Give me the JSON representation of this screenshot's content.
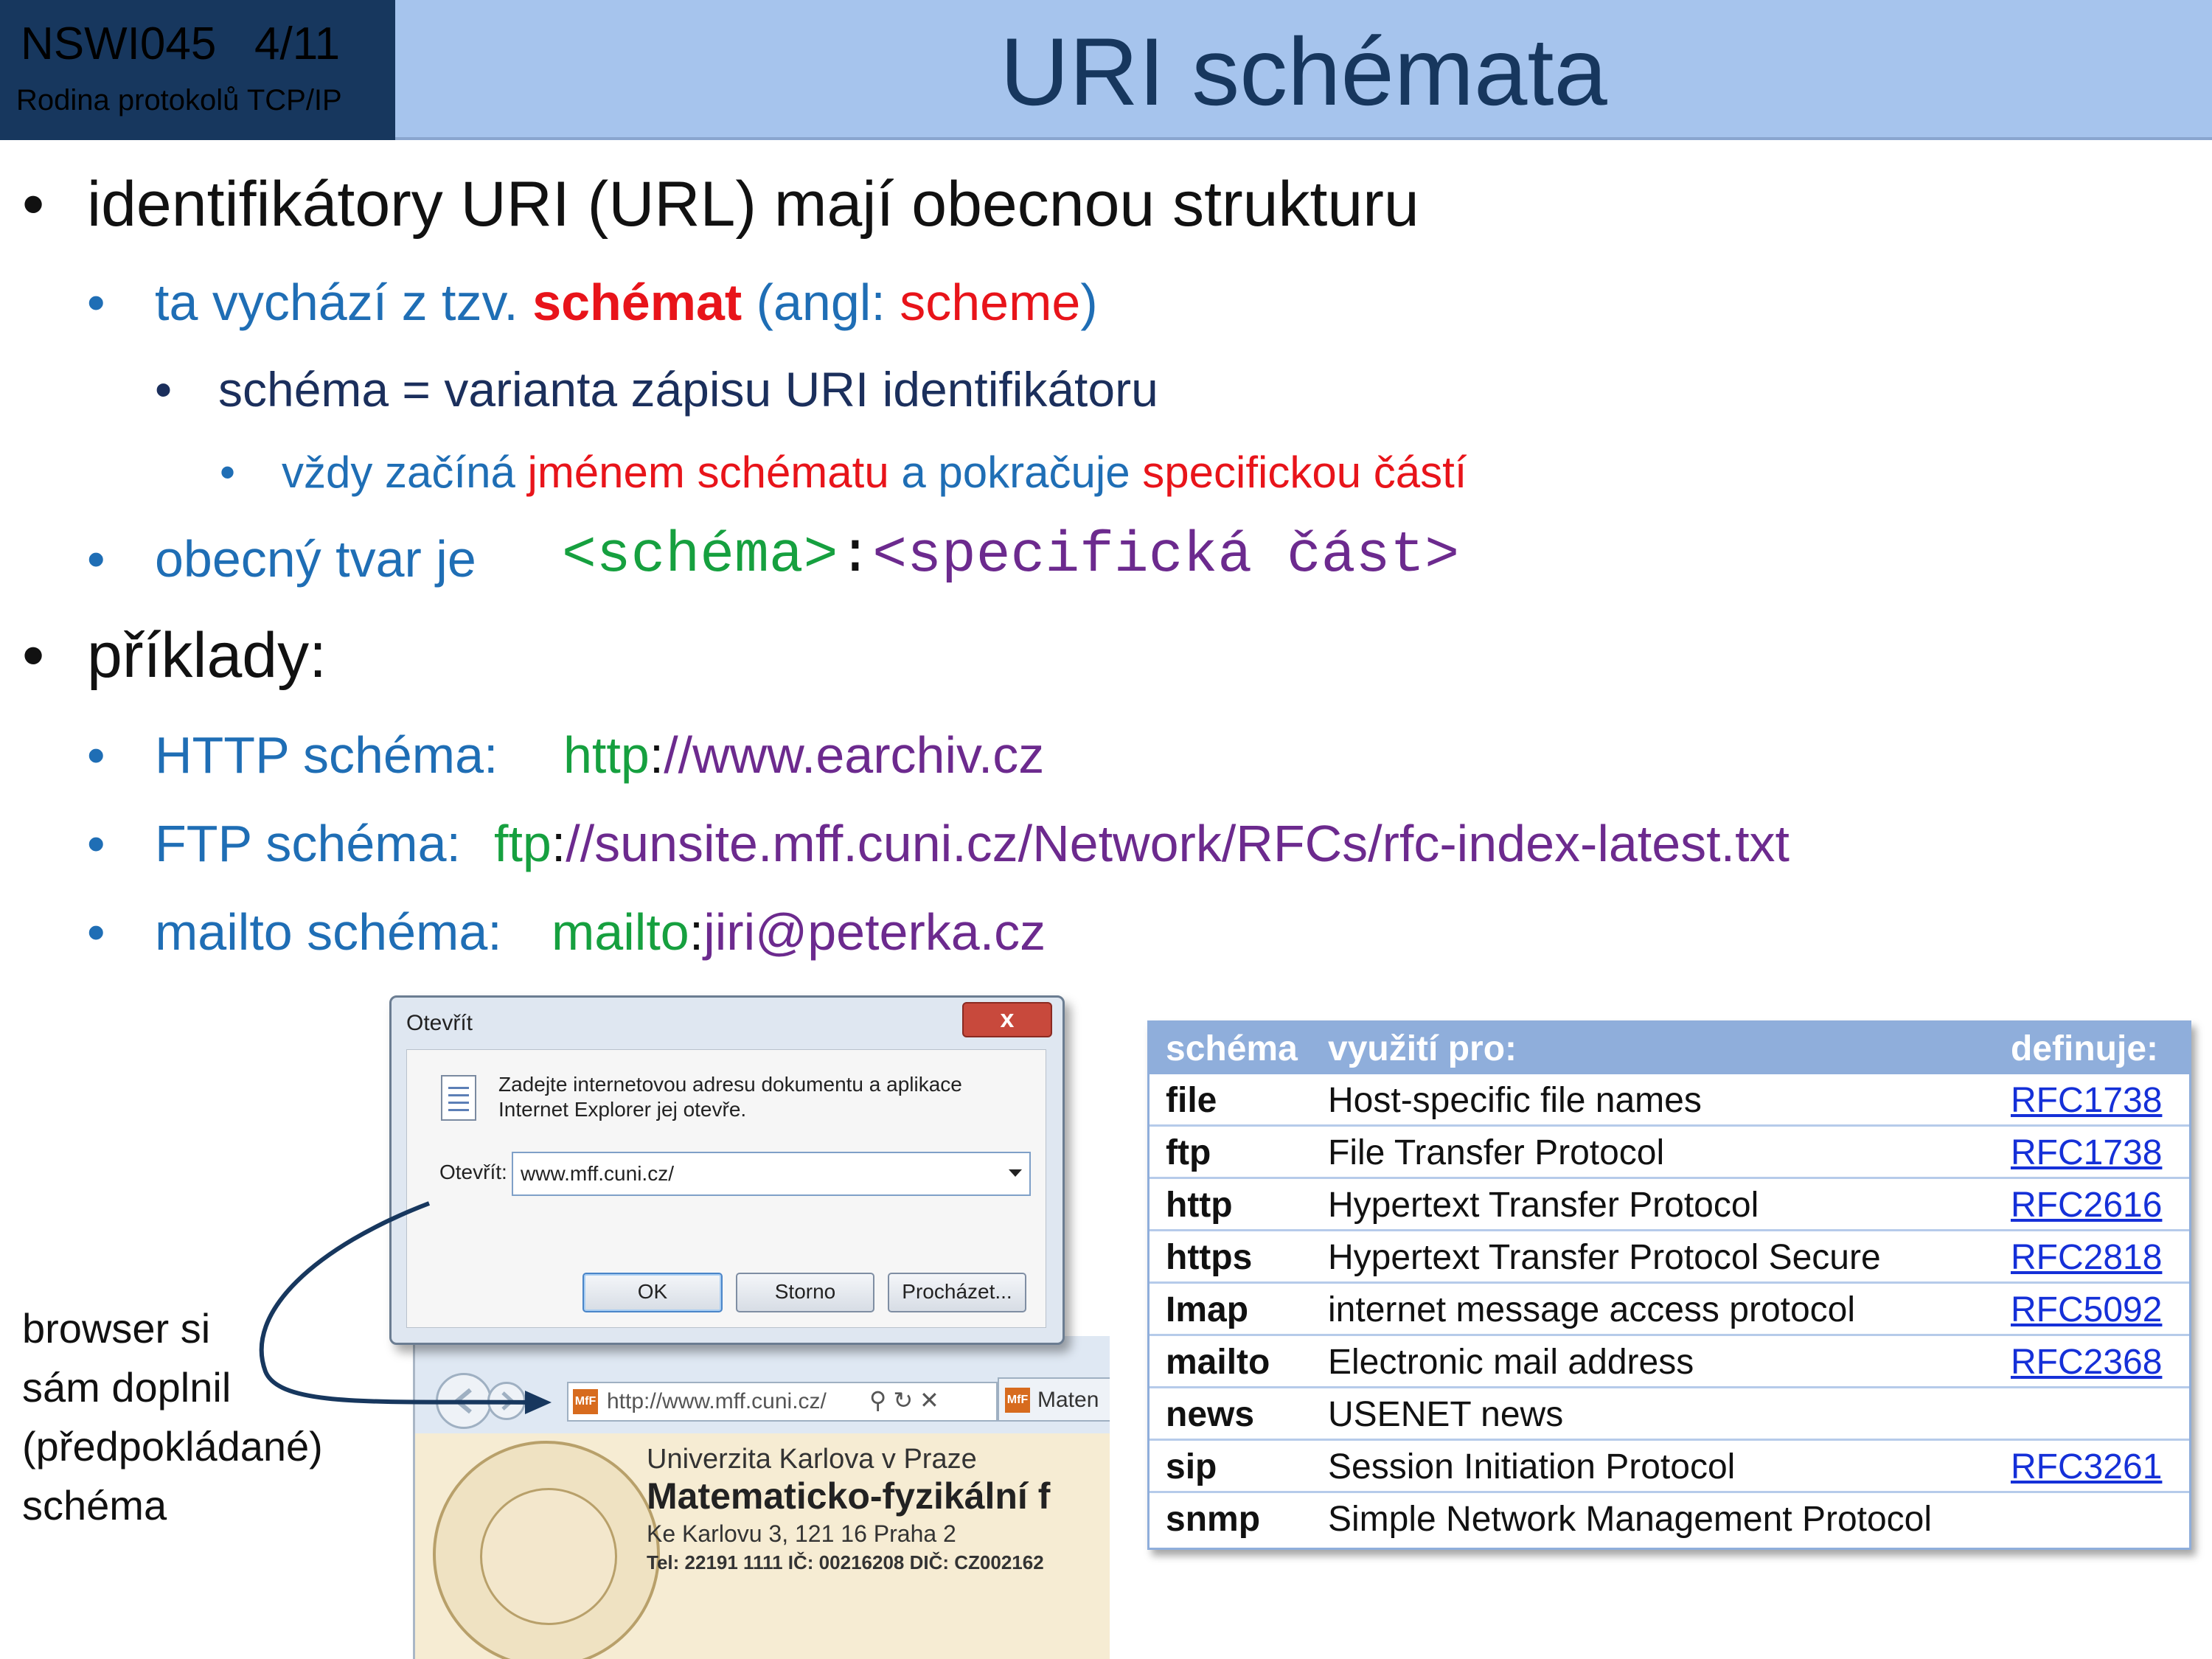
{
  "header": {
    "course_code": "NSWI045",
    "slide_number": "4/11",
    "subtitle": "Rodina protokolů TCP/IP",
    "title": "URI schémata"
  },
  "bullets": {
    "b1": "identifikátory URI (URL) mají obecnou strukturu",
    "b2_pre": "ta vychází z tzv. ",
    "b2_bold": "schémat",
    "b2_mid": " (angl: ",
    "b2_red": "scheme",
    "b2_post": ")",
    "b3": "schéma = varianta zápisu URI identifikátoru",
    "b4_pre": "vždy začíná ",
    "b4_red1": "jménem schématu",
    "b4_mid": " a pokračuje ",
    "b4_red2": "specifickou částí",
    "b5_label": "obecný tvar je",
    "b5_scheme": "<schéma>",
    "b5_colon": ":",
    "b5_specific": "<specifická část>",
    "b6": "příklady:",
    "ex_http_label": "HTTP schéma:",
    "ex_http_scheme": "http",
    "ex_http_colon": ":",
    "ex_http_rest": "//www.earchiv.cz",
    "ex_ftp_label": "FTP schéma:",
    "ex_ftp_scheme": "ftp",
    "ex_ftp_colon": ":",
    "ex_ftp_rest": "//sunsite.mff.cuni.cz/Network/RFCs/rfc-index-latest.txt",
    "ex_mailto_label": "mailto schéma:",
    "ex_mailto_scheme": "mailto",
    "ex_mailto_colon": ":",
    "ex_mailto_rest": "jiri@peterka.cz"
  },
  "dialog": {
    "title": "Otevřít",
    "close_label": "x",
    "message_line1": "Zadejte internetovou adresu dokumentu a aplikace",
    "message_line2": "Internet Explorer jej otevře.",
    "open_label": "Otevřít:",
    "input_value": "www.mff.cuni.cz/",
    "ok_label": "OK",
    "cancel_label": "Storno",
    "browse_label": "Procházet..."
  },
  "browser": {
    "address_url": "http://www.mff.cuni.cz/",
    "tab_label": "Maten",
    "favicon": "MfF",
    "university": "Univerzita Karlova v Praze",
    "faculty": "Matematicko-fyzikální f",
    "address": "Ke Karlovu 3, 121 16 Praha 2",
    "contacts": "Tel: 22191 1111   IČ: 00216208   DIČ: CZ002162"
  },
  "annotation": {
    "line1": "browser si",
    "line2": "sám doplnil",
    "line3": "(předpokládané)",
    "line4": "schéma"
  },
  "table": {
    "headers": [
      "schéma",
      "využití pro:",
      "definuje:"
    ],
    "rows": [
      [
        "file",
        "Host-specific file names",
        "RFC1738"
      ],
      [
        "ftp",
        "File Transfer Protocol",
        "RFC1738"
      ],
      [
        "http",
        "Hypertext Transfer Protocol",
        "RFC2616"
      ],
      [
        "https",
        "Hypertext Transfer Protocol Secure",
        "RFC2818"
      ],
      [
        "Imap",
        "internet message access protocol",
        "RFC5092"
      ],
      [
        "mailto",
        "Electronic mail address",
        "RFC2368"
      ],
      [
        "news",
        "USENET news",
        ""
      ],
      [
        "sip",
        "Session Initiation Protocol",
        "RFC3261"
      ],
      [
        "snmp",
        "Simple Network Management Protocol",
        ""
      ]
    ]
  },
  "colors": {
    "header_dark": "#17375e",
    "header_light": "#a6c4ed",
    "accent_blue": "#1f6eb5",
    "accent_red": "#e8141a",
    "accent_green": "#16a03f",
    "accent_purple": "#6c2a8e"
  }
}
